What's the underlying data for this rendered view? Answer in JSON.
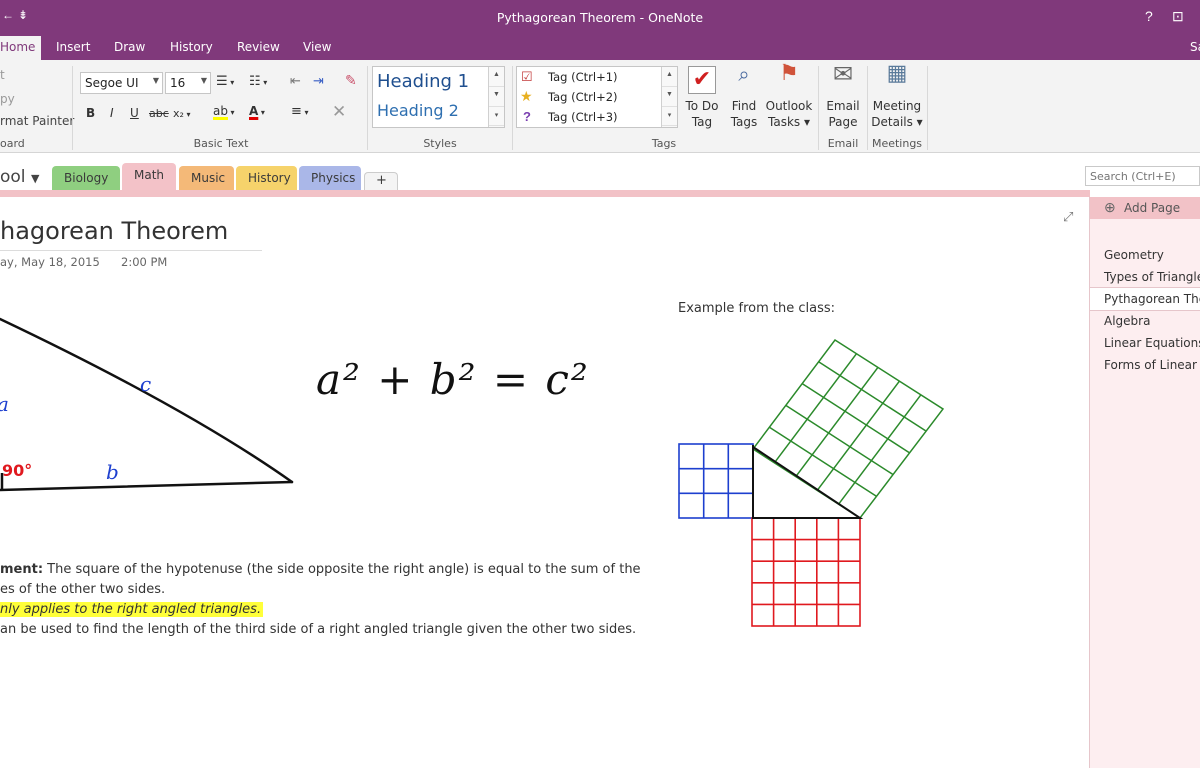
{
  "window": {
    "title": "Pythagorean Theorem - OneNote",
    "help_glyph": "?",
    "restore_glyph": "⊡",
    "user_initial": "Sa"
  },
  "ribbon_tabs": [
    {
      "label": "Home",
      "active": true
    },
    {
      "label": "Insert"
    },
    {
      "label": "Draw"
    },
    {
      "label": "History"
    },
    {
      "label": "Review"
    },
    {
      "label": "View"
    }
  ],
  "clipboard": {
    "cut": "t",
    "copy": "py",
    "format_painter": "rmat Painter",
    "label": "oard"
  },
  "basic_text": {
    "font": "Segoe UI",
    "size": "16",
    "label": "Basic Text",
    "bold": "B",
    "italic": "I",
    "underline": "U",
    "strike": "abc",
    "subscript": "x₂"
  },
  "styles": {
    "heading1": "Heading 1",
    "heading2": "Heading 2",
    "label": "Styles"
  },
  "tags": {
    "items": [
      "Tag (Ctrl+1)",
      "Tag (Ctrl+2)",
      "Tag (Ctrl+3)"
    ],
    "label": "Tags",
    "todo_tag": [
      "To Do",
      "Tag"
    ],
    "find_tags": [
      "Find",
      "Tags"
    ],
    "outlook_tasks": [
      "Outlook",
      "Tasks ▾"
    ]
  },
  "email": {
    "button": [
      "Email",
      "Page"
    ],
    "label": "Email"
  },
  "meetings": {
    "button": [
      "Meeting",
      "Details ▾"
    ],
    "label": "Meetings"
  },
  "notebook": {
    "name": "ool",
    "sections": [
      {
        "label": "Biology",
        "color": "#8fcf80"
      },
      {
        "label": "Math",
        "color": "#f3c2c8",
        "active": true
      },
      {
        "label": "Music",
        "color": "#f4b978"
      },
      {
        "label": "History",
        "color": "#f6d36b"
      },
      {
        "label": "Physics",
        "color": "#aab7e8"
      }
    ],
    "add_section": "+"
  },
  "search": {
    "placeholder": "Search (Ctrl+E)"
  },
  "pages_pane": {
    "add_page": "Add Page",
    "pages": [
      "Geometry",
      "Types of Triangles",
      "Pythagorean Theo",
      "Algebra",
      "Linear Equations",
      "Forms of Linear Eq"
    ],
    "selected_index": 2
  },
  "page": {
    "title": "hagorean Theorem",
    "date": "ay, May 18, 2015",
    "time": "2:00 PM",
    "example_label": "Example from the class:",
    "statement_bold": "ment:",
    "statement_rest": " The square of the hypotenuse (the side opposite the right angle) is equal to the sum of the",
    "statement_line2": "es of the other two sides.",
    "highlight_line": "nly applies to the right angled triangles.",
    "line4": "an be used to find the length of the third side of a right angled triangle given the other two sides.",
    "ink": {
      "a_label": "a",
      "b_label": "b",
      "c_label": "c",
      "angle_label": "90°",
      "formula": "a² + b² = c²"
    }
  },
  "colors": {
    "accent": "#80397b",
    "highlight": "#ffff3a",
    "ink_blue": "#1d3fcf",
    "ink_red": "#e0191f",
    "ink_green": "#2b8a2b"
  }
}
